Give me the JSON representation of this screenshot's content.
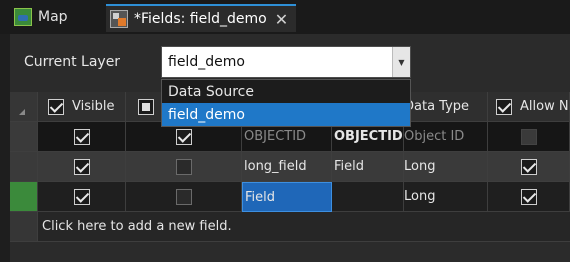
{
  "tabs": {
    "map": "Map",
    "fields": "*Fields: field_demo",
    "close": "✕"
  },
  "layer": {
    "label": "Current Layer",
    "value": "field_demo",
    "options": [
      "Data Source",
      "field_demo"
    ],
    "selected_index": 1
  },
  "grid": {
    "headers": {
      "visible": "Visible",
      "field_name": "",
      "alias": "",
      "data_type": "Data Type",
      "allow_null": "Allow NU"
    },
    "rows": [
      {
        "visible": true,
        "read_only": true,
        "name": "OBJECTID",
        "alias": "OBJECTID",
        "type": "Object ID",
        "allow_null": false
      },
      {
        "visible": true,
        "read_only": false,
        "name": "long_field",
        "alias": "Field",
        "type": "Long",
        "allow_null": true
      },
      {
        "visible": true,
        "read_only": false,
        "name": "Field",
        "alias": "",
        "type": "Long",
        "allow_null": true
      }
    ],
    "add_row": "Click here to add a new field."
  },
  "colors": {
    "accent": "#1f78c8",
    "background": "#2b2b2b",
    "new_row_marker": "#3b8a3b"
  }
}
